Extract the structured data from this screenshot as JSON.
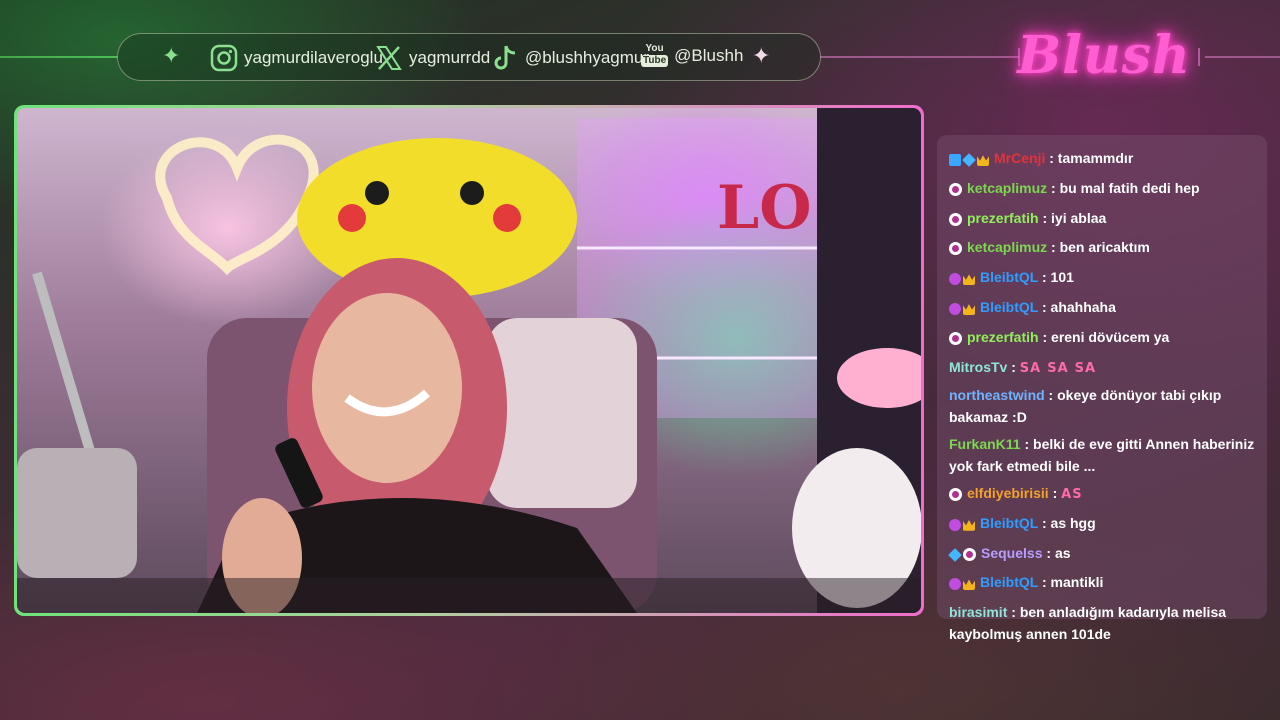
{
  "social": {
    "instagram_icon": "instagram-icon",
    "instagram": "yagmurdilaveroglu",
    "x_icon": "x-icon",
    "x": "yagmurrdd",
    "tiktok_icon": "tiktok-icon",
    "tiktok": "@blushhyagmur",
    "youtube_icon": "youtube-icon",
    "youtube_logo_top": "You",
    "youtube_logo_bottom": "Tube",
    "youtube": "@Blushh"
  },
  "brand": {
    "logo_text": "Blush",
    "color": "#ff5ed3"
  },
  "colors": {
    "frame_green": "#6fe37a",
    "frame_pink": "#f06ccc"
  },
  "chat": {
    "messages": [
      {
        "user": "MrCenji",
        "color": "#e0343c",
        "badges": [
          "blue",
          "cube",
          "crown"
        ],
        "text": "tamammdır"
      },
      {
        "user": "ketcaplimuz",
        "color": "#7bd84f",
        "badges": [
          "sub"
        ],
        "text": "bu mal fatih dedi hep"
      },
      {
        "user": "prezerfatih",
        "color": "#8ff05a",
        "badges": [
          "sub"
        ],
        "text": "iyi ablaa"
      },
      {
        "user": "ketcaplimuz",
        "color": "#7bd84f",
        "badges": [
          "sub"
        ],
        "text": "ben aricaktım"
      },
      {
        "user": "BleibtQL",
        "color": "#2f9dff",
        "badges": [
          "gift",
          "crown"
        ],
        "text": "101"
      },
      {
        "user": "BleibtQL",
        "color": "#2f9dff",
        "badges": [
          "gift",
          "crown"
        ],
        "text": "ahahhaha"
      },
      {
        "user": "prezerfatih",
        "color": "#8ff05a",
        "badges": [
          "sub"
        ],
        "text": "ereni dövücem ya"
      },
      {
        "user": "MitrosTv",
        "color": "#8ee6d6",
        "badges": [],
        "text": "",
        "emotes": [
          "SA",
          "SA",
          "SA"
        ]
      },
      {
        "user": "northeastwind",
        "color": "#6fb2ff",
        "badges": [],
        "text": "okeye dönüyor tabi çıkıp bakamaz :D"
      },
      {
        "user": "FurkanK11",
        "color": "#7bd84f",
        "badges": [],
        "text": "belki de eve gitti Annen haberiniz yok fark etmedi bile ..."
      },
      {
        "user": "elfdiyebirisii",
        "color": "#f3a12b",
        "badges": [
          "sub"
        ],
        "text": "",
        "emotes": [
          "AS"
        ]
      },
      {
        "user": "BleibtQL",
        "color": "#2f9dff",
        "badges": [
          "gift",
          "crown"
        ],
        "text": "as hgg"
      },
      {
        "user": "Sequelss",
        "color": "#b69cff",
        "badges": [
          "cube",
          "sub"
        ],
        "text": "as"
      },
      {
        "user": "BleibtQL",
        "color": "#2f9dff",
        "badges": [
          "gift",
          "crown"
        ],
        "text": "mantikli"
      },
      {
        "user": "birasimit",
        "color": "#8ee6d6",
        "badges": [],
        "text": "ben anladığım kadarıyla melisa kaybolmuş annen 101de"
      }
    ]
  }
}
